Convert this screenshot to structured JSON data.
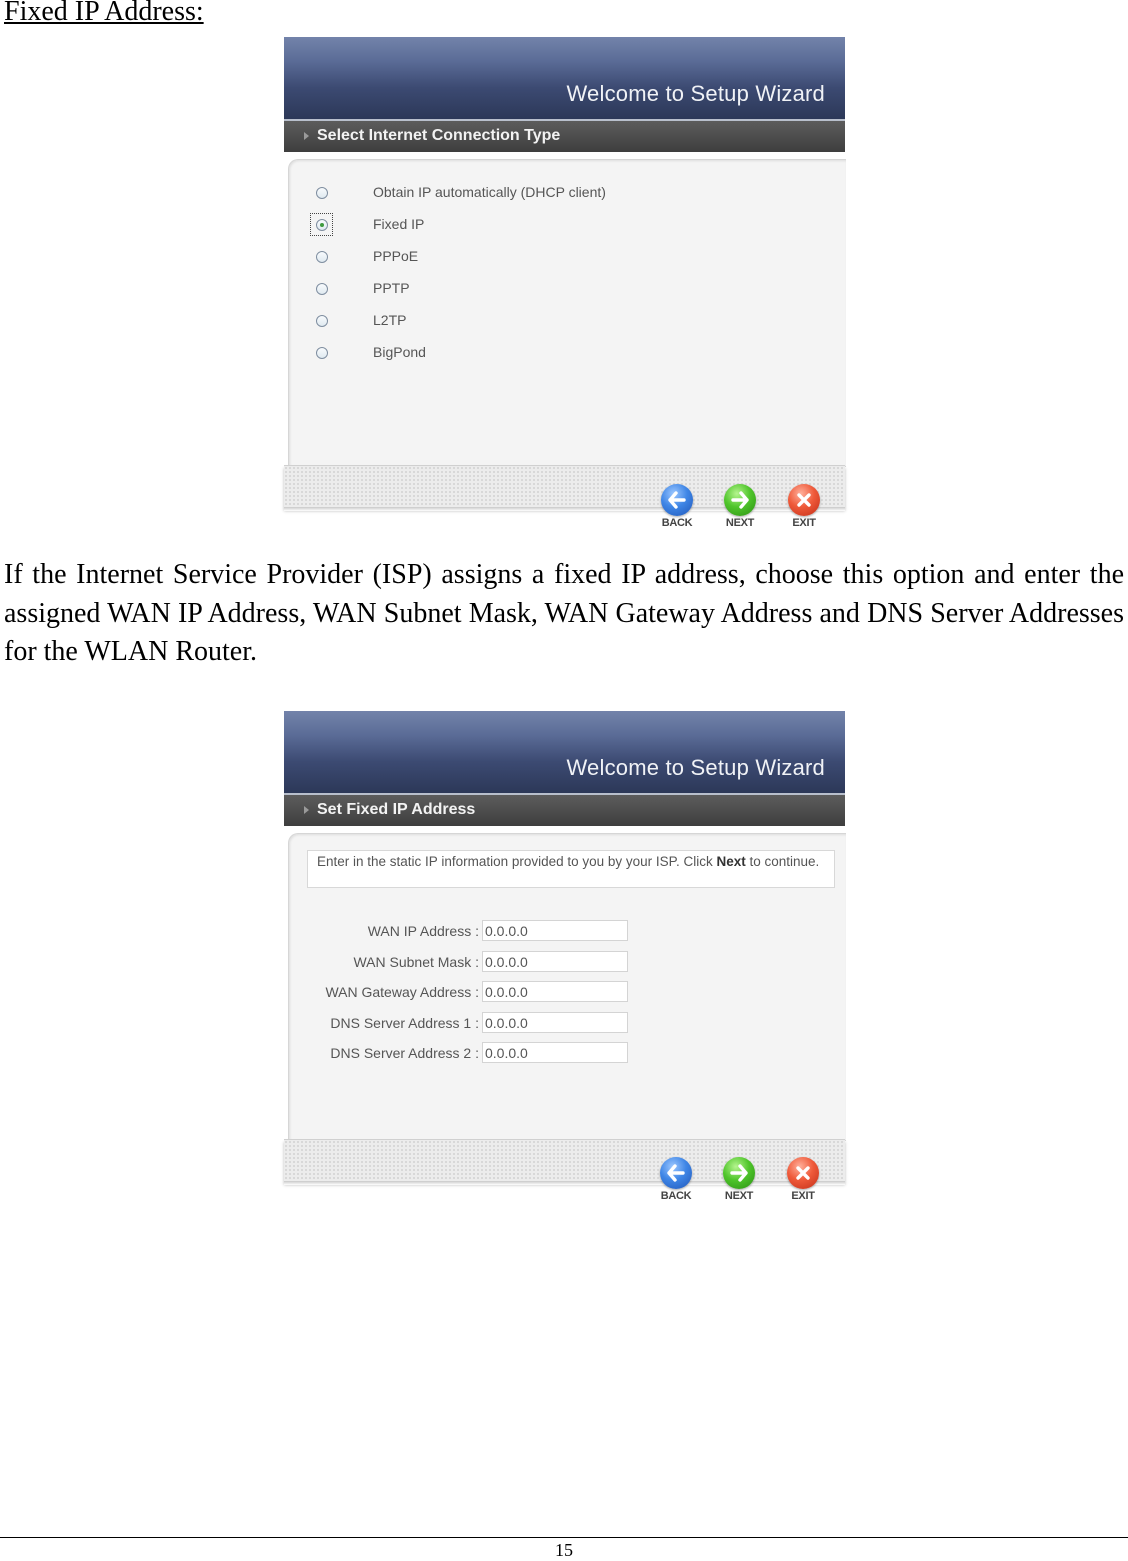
{
  "document": {
    "heading": "Fixed IP Address:",
    "paragraph": "If the Internet Service Provider (ISP) assigns a fixed IP address, choose this option and enter the assigned WAN IP Address, WAN Subnet Mask, WAN Gateway Address and DNS Server Addresses for the WLAN Router.",
    "page_number": "15"
  },
  "wizard1": {
    "title": "Welcome to Setup Wizard",
    "section": "Select Internet Connection Type",
    "options": [
      {
        "label": "Obtain IP automatically (DHCP client)",
        "checked": false
      },
      {
        "label": "Fixed IP",
        "checked": true
      },
      {
        "label": "PPPoE",
        "checked": false
      },
      {
        "label": "PPTP",
        "checked": false
      },
      {
        "label": "L2TP",
        "checked": false
      },
      {
        "label": "BigPond",
        "checked": false
      }
    ],
    "buttons": {
      "back": "BACK",
      "next": "NEXT",
      "exit": "EXIT"
    }
  },
  "wizard2": {
    "title": "Welcome to Setup Wizard",
    "section": "Set Fixed IP Address",
    "info": {
      "before": "Enter in the static IP information provided to you by your ISP. Click ",
      "bold": "Next",
      "after": " to continue."
    },
    "fields": [
      {
        "label": "WAN IP Address :",
        "value": "0.0.0.0"
      },
      {
        "label": "WAN Subnet Mask :",
        "value": "0.0.0.0"
      },
      {
        "label": "WAN Gateway Address :",
        "value": "0.0.0.0"
      },
      {
        "label": "DNS Server Address 1 :",
        "value": "0.0.0.0"
      },
      {
        "label": "DNS Server Address 2 :",
        "value": "0.0.0.0"
      }
    ],
    "buttons": {
      "back": "BACK",
      "next": "NEXT",
      "exit": "EXIT"
    }
  }
}
